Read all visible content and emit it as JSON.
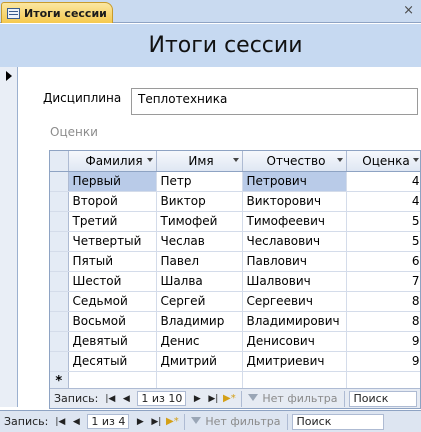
{
  "tab": {
    "label": "Итоги сессии",
    "close": "×"
  },
  "form": {
    "title": "Итоги сессии",
    "discipline_label": "Дисциплина",
    "discipline_value": "Теплотехника",
    "grades_label": "Оценки"
  },
  "grid": {
    "columns": [
      "Фамилия",
      "Имя",
      "Отчество",
      "Оценка"
    ],
    "rows": [
      [
        "Первый",
        "Петр",
        "Петрович",
        "4"
      ],
      [
        "Второй",
        "Виктор",
        "Викторович",
        "4"
      ],
      [
        "Третий",
        "Тимофей",
        "Тимофеевич",
        "5"
      ],
      [
        "Четвертый",
        "Чеслав",
        "Чеславович",
        "5"
      ],
      [
        "Пятый",
        "Павел",
        "Павлович",
        "6"
      ],
      [
        "Шестой",
        "Шалва",
        "Шалвович",
        "7"
      ],
      [
        "Седьмой",
        "Сергей",
        "Сергеевич",
        "8"
      ],
      [
        "Восьмой",
        "Владимир",
        "Владимирович",
        "8"
      ],
      [
        "Девятый",
        "Денис",
        "Денисович",
        "9"
      ],
      [
        "Десятый",
        "Дмитрий",
        "Дмитриевич",
        "9"
      ]
    ],
    "new_row_marker": "*"
  },
  "subnav": {
    "label": "Запись:",
    "position": "1 из 10",
    "filter": "Нет фильтра",
    "search_placeholder": "Поиск"
  },
  "mainnav": {
    "label": "Запись:",
    "position": "1 из 4",
    "filter": "Нет фильтра",
    "search_placeholder": "Поиск"
  },
  "icons": {
    "first": "first-record-icon",
    "prev": "prev-record-icon",
    "next": "next-record-icon",
    "last": "last-record-icon",
    "new": "new-record-icon",
    "filter": "filter-icon"
  }
}
